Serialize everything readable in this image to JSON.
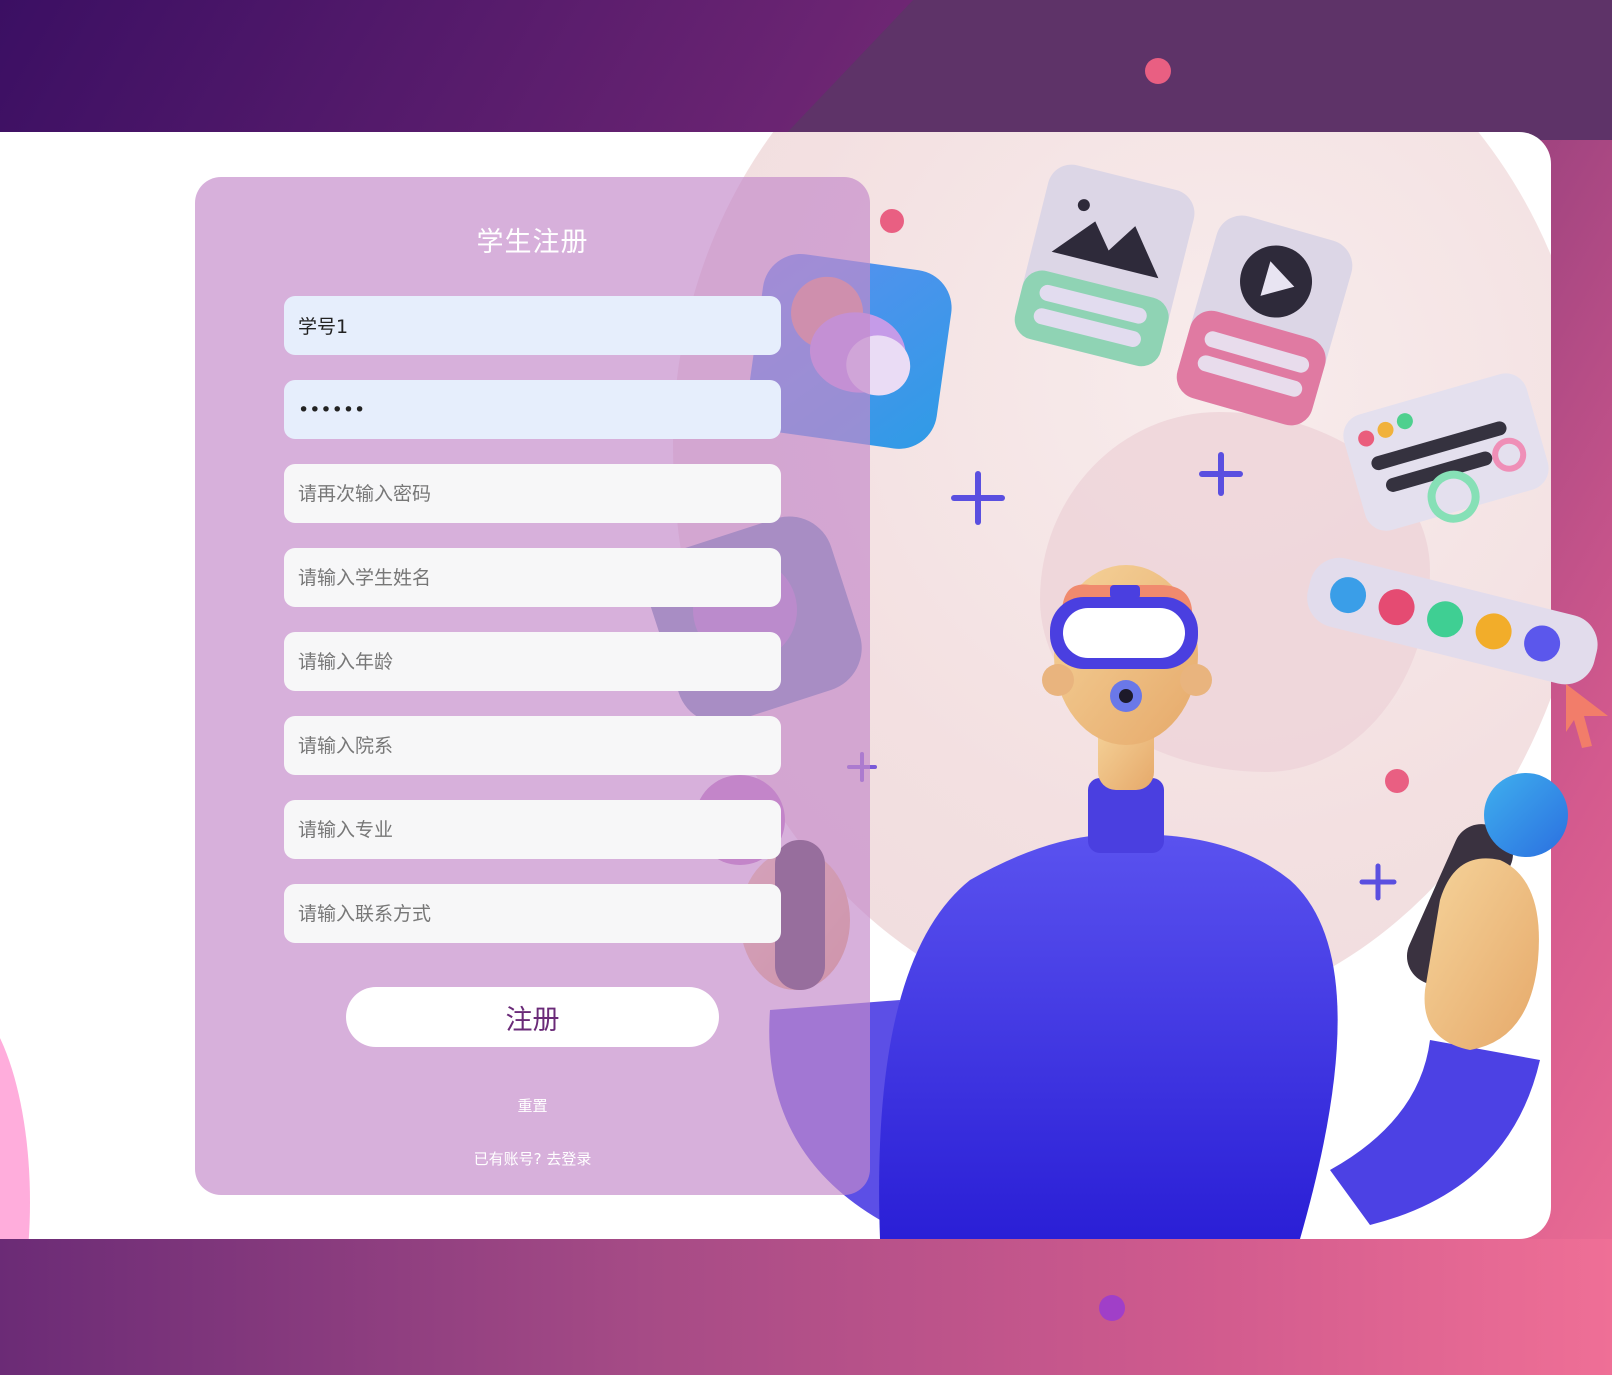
{
  "form": {
    "title": "学生注册",
    "student_id_value": "学号1",
    "password_value": "••••••",
    "confirm_password_placeholder": "请再次输入密码",
    "name_placeholder": "请输入学生姓名",
    "age_placeholder": "请输入年龄",
    "department_placeholder": "请输入院系",
    "major_placeholder": "请输入专业",
    "contact_placeholder": "请输入联系方式",
    "submit_label": "注册",
    "reset_label": "重置",
    "login_prompt": "已有账号? ",
    "login_link": "去登录"
  },
  "colors": {
    "accent": "#6a2a78",
    "panel": "#c48aca",
    "illustration_primary": "#4a3fe0"
  },
  "icons": [
    "image-card-icon",
    "play-card-icon",
    "settings-card-icon",
    "color-palette-icon",
    "cursor-icon",
    "vr-headset-icon",
    "plus-icon"
  ]
}
